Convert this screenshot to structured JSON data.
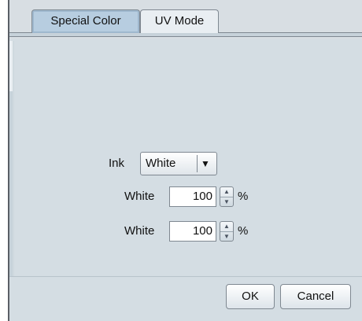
{
  "dialog": {
    "tabs": [
      {
        "label": "Special Color",
        "active": true
      },
      {
        "label": "UV Mode",
        "active": false
      }
    ],
    "form": {
      "ink_label": "Ink",
      "ink_value": "White",
      "rows": [
        {
          "label": "White",
          "value": "100",
          "unit": "%"
        },
        {
          "label": "White",
          "value": "100",
          "unit": "%"
        }
      ]
    },
    "buttons": {
      "ok": "OK",
      "cancel": "Cancel"
    }
  },
  "colors": {
    "dialog_background": "#d4dde3",
    "active_tab": "#b7cde0",
    "inactive_tab": "#e9eef2",
    "border": "#7f8891"
  },
  "icons": {
    "dropdown": "chevron-down-icon",
    "spin_up": "chevron-up-icon",
    "spin_down": "chevron-down-icon"
  }
}
